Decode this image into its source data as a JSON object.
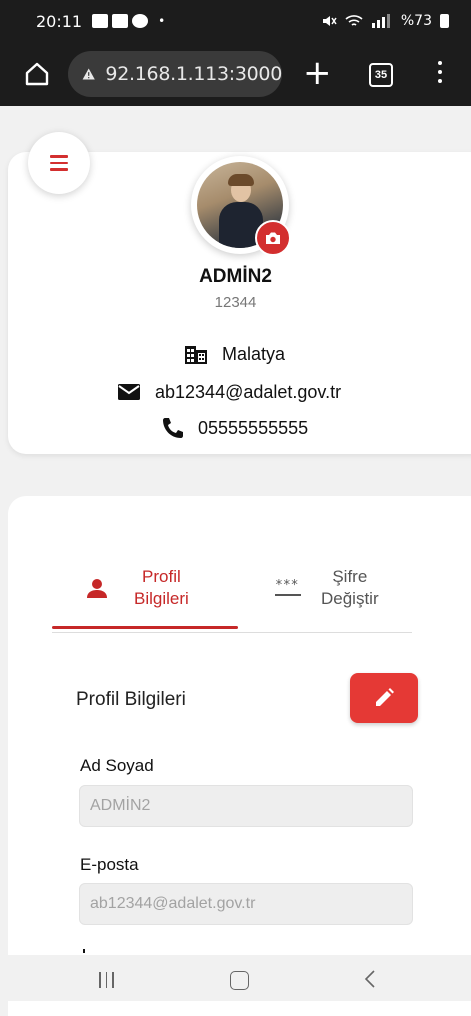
{
  "status_bar": {
    "time": "20:11",
    "dot": "•",
    "battery": "%73"
  },
  "browser": {
    "url": "92.168.1.113:3000",
    "tab_count": "35"
  },
  "profile": {
    "name": "ADMİN2",
    "number": "12344",
    "city": "Malatya",
    "email": "ab12344@adalet.gov.tr",
    "phone": "05555555555"
  },
  "tabs": {
    "profile_line1": "Profil",
    "profile_line2": "Bilgileri",
    "password_line1": "Şifre",
    "password_line2": "Değiştir",
    "password_icon": "***"
  },
  "section": {
    "title": "Profil Bilgileri"
  },
  "fields": {
    "name_label": "Ad Soyad",
    "name_value": "ADMİN2",
    "email_label": "E-posta",
    "email_value": "ab12344@adalet.gov.tr"
  },
  "colors": {
    "accent": "#d32f2f",
    "edit_button": "#e53935"
  }
}
